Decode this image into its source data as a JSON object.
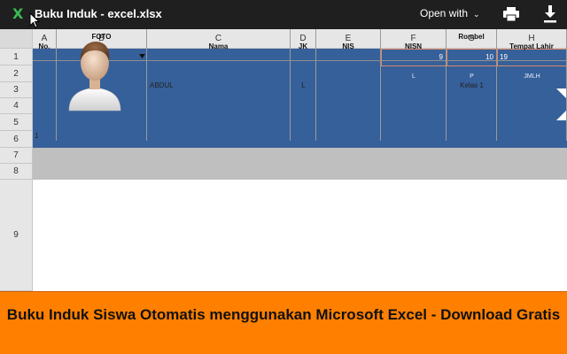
{
  "topbar": {
    "title": "Buku Induk - excel.xlsx",
    "open_with_label": "Open with",
    "icons": [
      "excel-icon",
      "chevron-down-icon",
      "print-icon",
      "download-icon"
    ]
  },
  "sheet": {
    "columns": [
      "A",
      "B",
      "C",
      "D",
      "E",
      "F",
      "G",
      "H"
    ],
    "rows": [
      "1",
      "2",
      "3",
      "4",
      "5",
      "6",
      "7",
      "8",
      "9"
    ],
    "summary_values": [
      "9",
      "10",
      "19"
    ],
    "summary_labels": [
      "L",
      "P",
      "JMLH"
    ],
    "headers": {
      "no": "No.",
      "foto": "FOTO",
      "nama": "Nama",
      "jk": "JK",
      "nis": "NIS",
      "nisn": "NISN",
      "rombel": "Rombel",
      "tempat_lahir": "Tempat Lahir"
    },
    "record": {
      "no": "1",
      "nama": "ABDUL",
      "jk": "L",
      "rombel": "Kelas 1"
    },
    "colors": {
      "header_fill": "#36609a",
      "table_header_fill": "#bfbfbf",
      "accent_border": "#d98a6a"
    }
  },
  "banner": {
    "text": "Buku Induk Siswa Otomatis menggunakan Microsoft Excel - Download Gratis",
    "color": "#ff8000"
  }
}
